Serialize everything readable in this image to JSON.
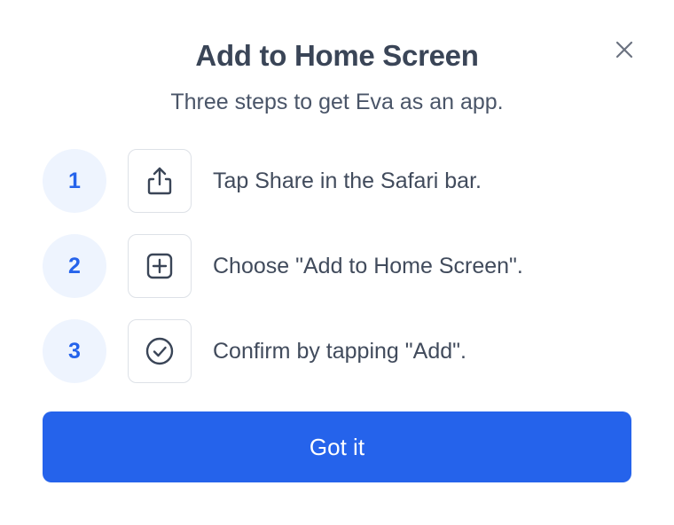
{
  "dialog": {
    "title": "Add to Home Screen",
    "subtitle": "Three steps to get Eva as an app.",
    "close_icon": "close-icon"
  },
  "steps": [
    {
      "number": "1",
      "icon": "share-icon",
      "text": "Tap Share in the Safari bar."
    },
    {
      "number": "2",
      "icon": "add-square-icon",
      "text": "Choose \"Add to Home Screen\"."
    },
    {
      "number": "3",
      "icon": "check-circle-icon",
      "text": "Confirm by tapping \"Add\"."
    }
  ],
  "button": {
    "label": "Got it"
  },
  "colors": {
    "accent": "#2563eb",
    "step_badge_bg": "#eef4fe",
    "text": "#3f4a5c"
  }
}
